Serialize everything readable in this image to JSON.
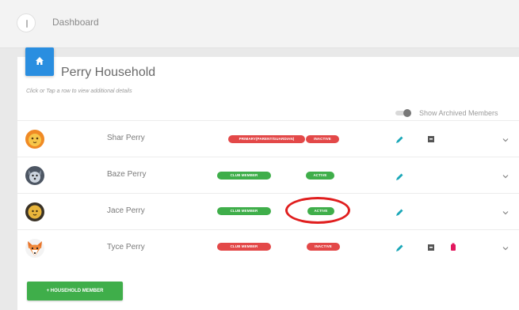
{
  "breadcrumb": "Dashboard",
  "household": {
    "title": "Perry Household",
    "hint": "Click or Tap a row to view additional details"
  },
  "archived_toggle": {
    "label": "Show Archived Members",
    "on": false
  },
  "members": [
    {
      "name": "Shar Perry",
      "role": "PRIMARY(PARENT/GUARDIAN)",
      "status": "INACTIVE",
      "avatar": "lion-face-icon"
    },
    {
      "name": "Baze Perry",
      "role": "CLUB MEMBER",
      "status": "ACTIVE",
      "avatar": "wolf-face-icon"
    },
    {
      "name": "Jace Perry",
      "role": "CLUB MEMBER",
      "status": "ACTIVE",
      "avatar": "lion-face-icon"
    },
    {
      "name": "Tyce Perry",
      "role": "CLUB MEMBER",
      "status": "INACTIVE",
      "avatar": "fox-face-icon"
    }
  ],
  "add_button": "+ HOUSEHOLD MEMBER",
  "colors": {
    "accent_blue": "#2a8ee0",
    "pill_red": "#e34848",
    "pill_green": "#3fae4a",
    "trash_pink": "#e2185e",
    "highlight_red": "#e01e1e"
  }
}
